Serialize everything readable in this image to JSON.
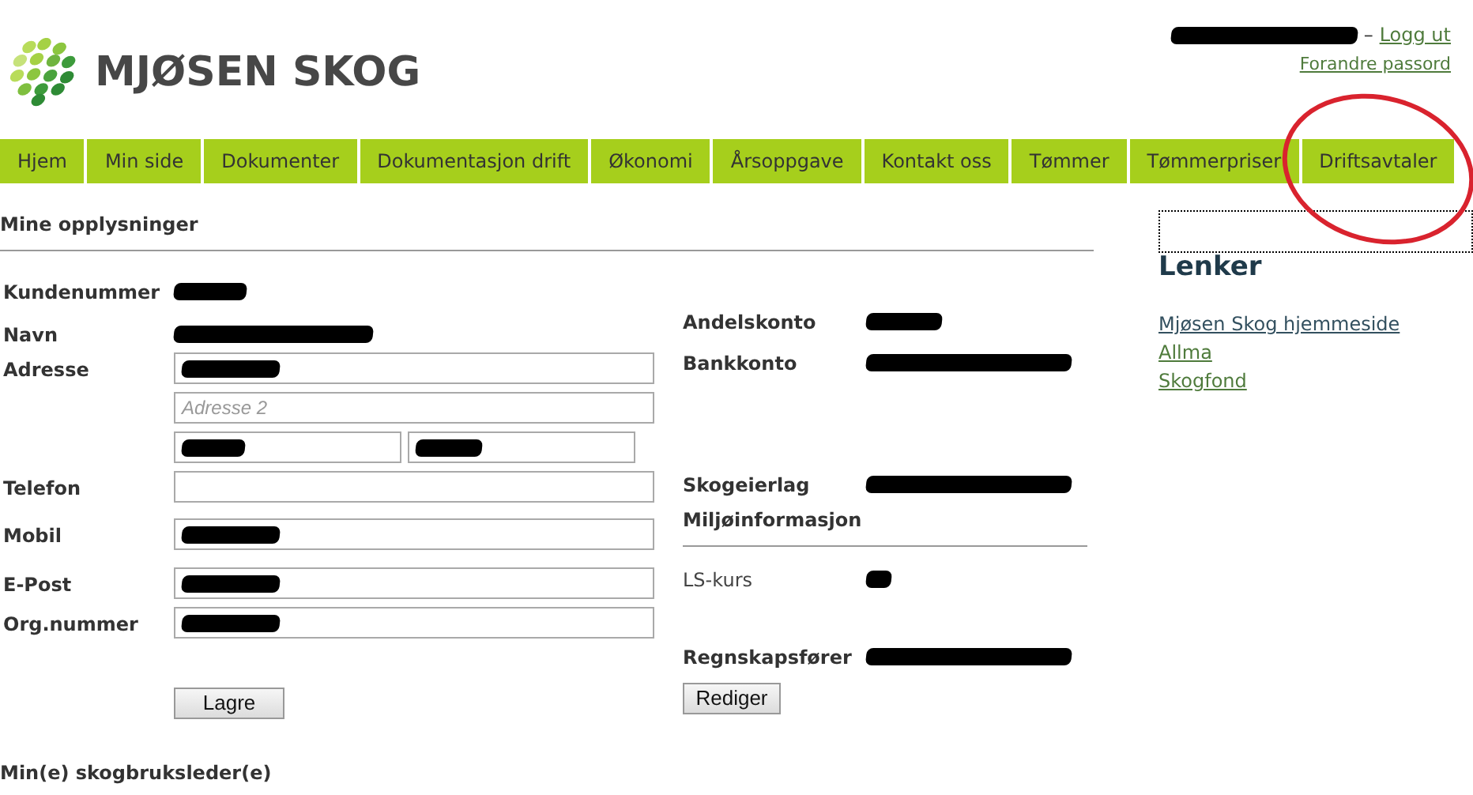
{
  "header": {
    "logo_text": "MJØSEN SKOG",
    "user": {
      "redacted": true
    },
    "separator": "–",
    "logout": "Logg ut",
    "change_password": "Forandre passord"
  },
  "nav": {
    "items": [
      {
        "label": "Hjem"
      },
      {
        "label": "Min side"
      },
      {
        "label": "Dokumenter"
      },
      {
        "label": "Dokumentasjon drift"
      },
      {
        "label": "Økonomi"
      },
      {
        "label": "Årsoppgave"
      },
      {
        "label": "Kontakt oss"
      },
      {
        "label": "Tømmer"
      },
      {
        "label": "Tømmerpriser"
      },
      {
        "label": "Driftsavtaler"
      }
    ]
  },
  "profile": {
    "title": "Mine opplysninger",
    "left_fields": [
      {
        "kind": "text",
        "label": "Kundenummer",
        "redacted": true
      },
      {
        "kind": "text",
        "label": "Navn",
        "redacted": true
      },
      {
        "kind": "input",
        "label": "Adresse",
        "redacted": true
      },
      {
        "kind": "input",
        "placeholder": "Adresse 2",
        "redacted": false
      },
      {
        "kind": "pair",
        "redacted": true
      },
      {
        "kind": "input",
        "label": "Telefon",
        "redacted": false
      },
      {
        "kind": "input",
        "label": "Mobil",
        "redacted": true
      },
      {
        "kind": "input",
        "label": "E-Post",
        "redacted": true
      },
      {
        "kind": "input",
        "label": "Org.nummer",
        "redacted": true
      }
    ],
    "save_button": "Lagre",
    "right_fields": [
      {
        "kind": "text",
        "label": "Andelskonto",
        "redacted": true
      },
      {
        "kind": "text",
        "label": "Bankkonto",
        "redacted": true
      },
      {
        "kind": "text",
        "label": "Skogeierlag",
        "redacted": true
      },
      {
        "kind": "heading",
        "label": "Miljøinformasjon"
      },
      {
        "kind": "plain",
        "label": "LS-kurs",
        "redacted": true
      },
      {
        "kind": "text",
        "label": "Regnskapsfører",
        "redacted": true
      }
    ],
    "edit_button": "Rediger"
  },
  "managers": {
    "title": "Min(e) skogbruksleder(e)"
  },
  "sidebar": {
    "title": "Lenker",
    "links": [
      {
        "label": "Mjøsen Skog hjemmeside",
        "color": "#33505f"
      },
      {
        "label": "Allma",
        "color": "#4f7b3c"
      },
      {
        "label": "Skogfond",
        "color": "#4f7b3c"
      }
    ]
  }
}
